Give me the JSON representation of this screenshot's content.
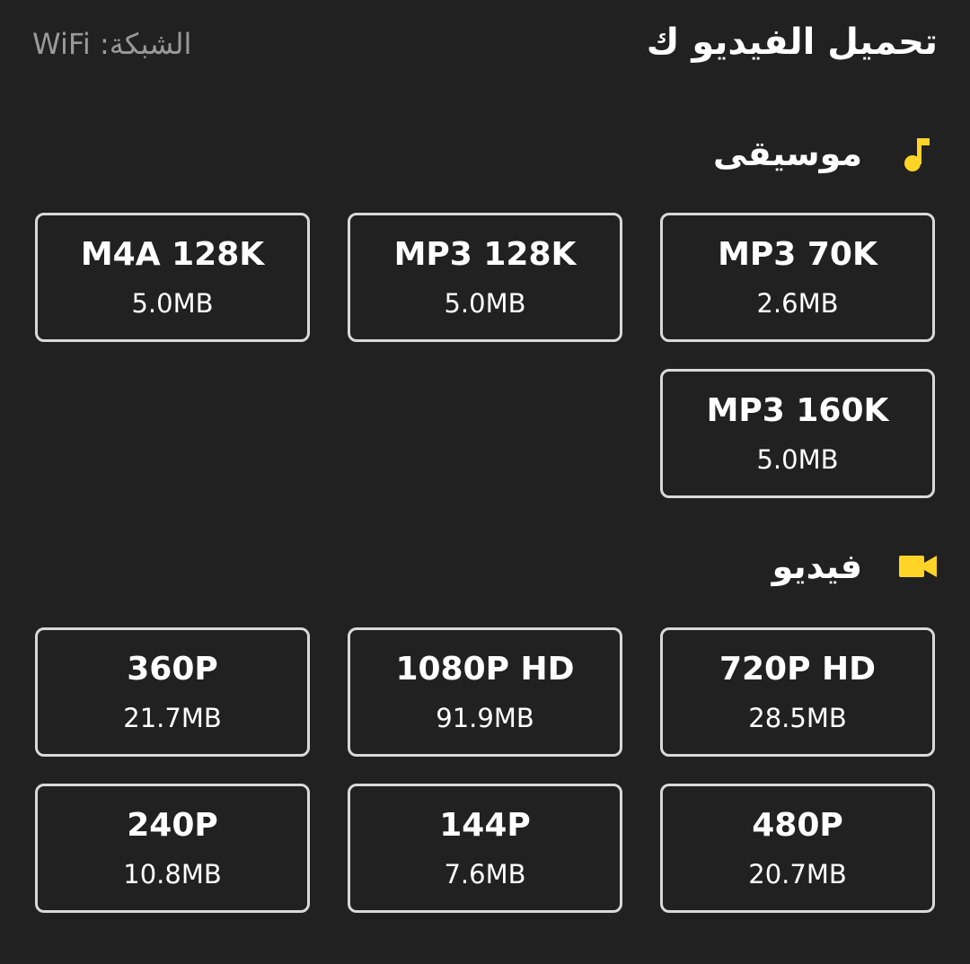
{
  "header": {
    "title": "تحميل الفيديو ك",
    "network_label": "الشبكة: WiFi"
  },
  "music": {
    "label": "موسيقى",
    "icon": "music-note-icon",
    "accent": "#ffd426",
    "options": [
      {
        "format": "MP3 70K",
        "size": "2.6MB"
      },
      {
        "format": "MP3 128K",
        "size": "5.0MB"
      },
      {
        "format": "M4A 128K",
        "size": "5.0MB"
      },
      {
        "format": "MP3 160K",
        "size": "5.0MB"
      }
    ]
  },
  "video": {
    "label": "فيديو",
    "icon": "video-camera-icon",
    "accent": "#ffd426",
    "options": [
      {
        "format": "720P HD",
        "size": "28.5MB"
      },
      {
        "format": "1080P HD",
        "size": "91.9MB"
      },
      {
        "format": "360P",
        "size": "21.7MB"
      },
      {
        "format": "480P",
        "size": "20.7MB"
      },
      {
        "format": "144P",
        "size": "7.6MB"
      },
      {
        "format": "240P",
        "size": "10.8MB"
      }
    ]
  }
}
